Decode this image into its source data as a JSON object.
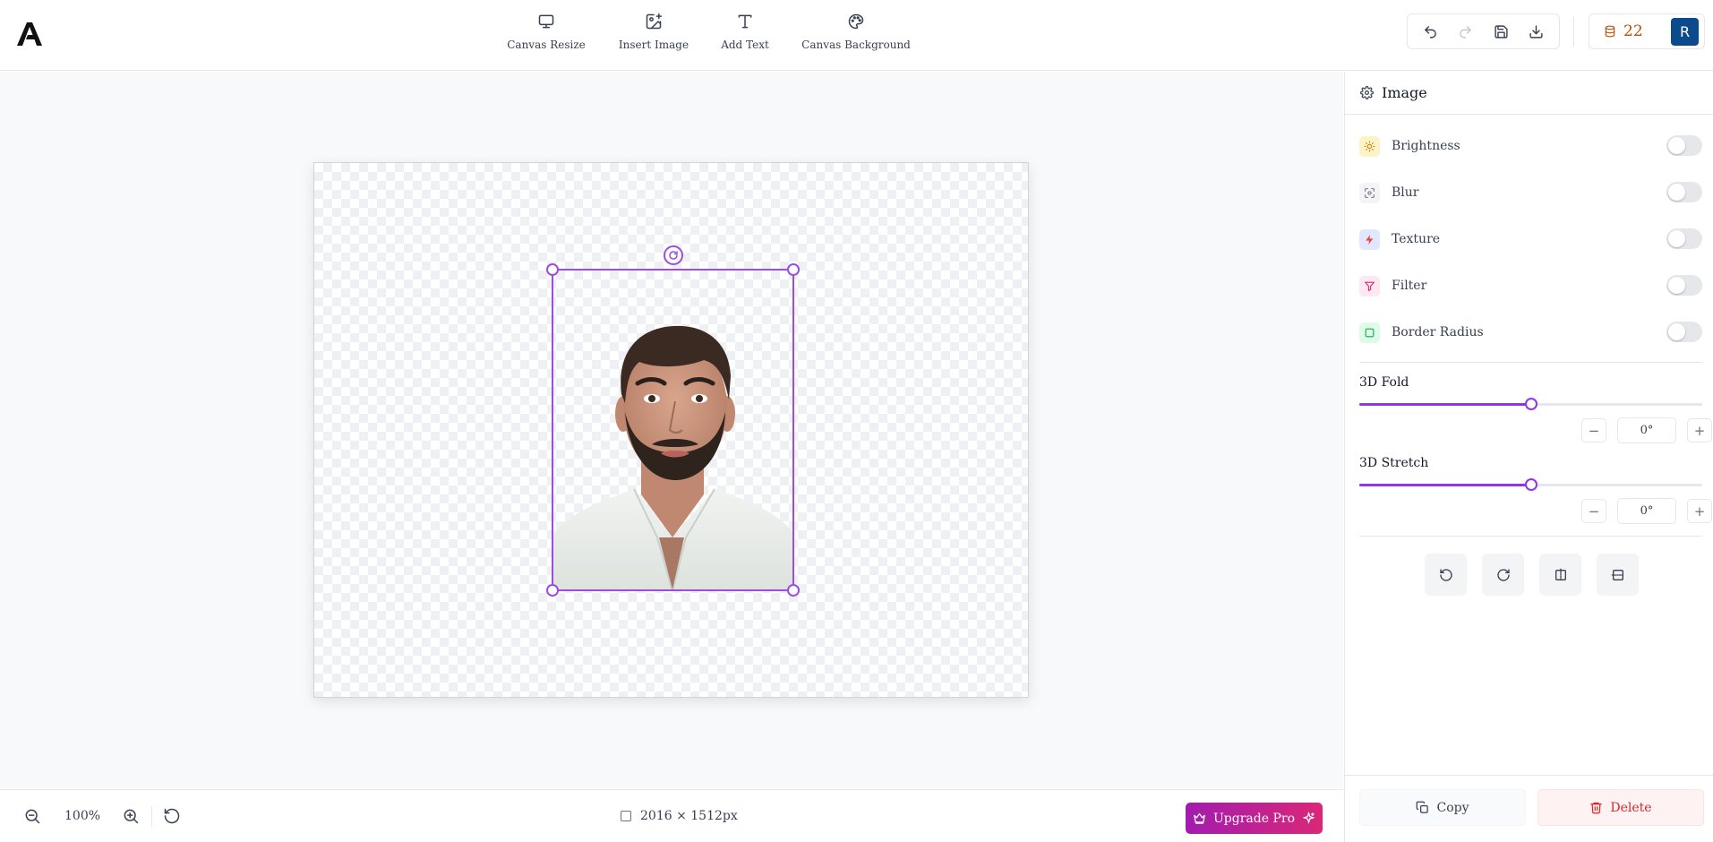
{
  "toolbar": {
    "tools": [
      {
        "label": "Canvas Resize",
        "icon": "monitor-icon"
      },
      {
        "label": "Insert Image",
        "icon": "image-plus-icon"
      },
      {
        "label": "Add Text",
        "icon": "text-icon"
      },
      {
        "label": "Canvas Background",
        "icon": "palette-icon"
      }
    ],
    "history": [
      "undo-icon",
      "redo-icon",
      "save-icon",
      "download-icon"
    ],
    "credits": "22",
    "avatar_initial": "R"
  },
  "canvas": {
    "zoom": "100%",
    "dimensions": "2016 × 1512px"
  },
  "bottom": {
    "upgrade_label": "Upgrade Pro"
  },
  "panel": {
    "title": "Image",
    "options": [
      {
        "label": "Brightness",
        "enabled": false,
        "color": "#fef3c7",
        "icon_color": "#d97706"
      },
      {
        "label": "Blur",
        "enabled": false,
        "color": "#f3f4f6",
        "icon_color": "#6b7280"
      },
      {
        "label": "Texture",
        "enabled": false,
        "color": "#e0e7ff",
        "icon_color": "#ef4444"
      },
      {
        "label": "Filter",
        "enabled": false,
        "color": "#fce7f3",
        "icon_color": "#db2777"
      },
      {
        "label": "Border Radius",
        "enabled": false,
        "color": "#dcfce7",
        "icon_color": "#16a34a"
      }
    ],
    "fold": {
      "label": "3D Fold",
      "value": "0°",
      "level": 0.5
    },
    "stretch": {
      "label": "3D Stretch",
      "value": "0°",
      "level": 0.5
    },
    "copy_label": "Copy",
    "delete_label": "Delete"
  },
  "colors": {
    "accent": "#9333ea",
    "selection": "#9b4ee0",
    "avatar": "#0b4a8c",
    "credits": "#b45309"
  }
}
